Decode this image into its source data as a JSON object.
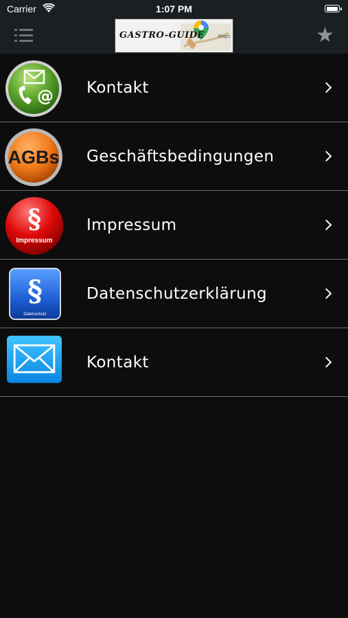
{
  "status_bar": {
    "carrier": "Carrier",
    "time": "1:07 PM"
  },
  "nav": {
    "logo_text": "GASTRO-GUIDE",
    "logo_maps": "Maps",
    "menu_icon": "hamburger-icon",
    "favorite_icon": "star-icon"
  },
  "list": {
    "items": [
      {
        "label": "Kontakt",
        "icon": "phone-mail-icon"
      },
      {
        "label": "Geschäftsbedingungen",
        "icon": "agbs-icon",
        "icon_text": "AGBs"
      },
      {
        "label": "Impressum",
        "icon": "impressum-icon",
        "icon_text": "Impressum"
      },
      {
        "label": "Datenschutzerklärung",
        "icon": "datenschutz-icon",
        "icon_text": "Datenschutz"
      },
      {
        "label": "Kontakt",
        "icon": "mail-icon"
      }
    ]
  },
  "colors": {
    "background": "#0d0d0d",
    "bar": "#1c1f22",
    "divider": "#6e6e6e",
    "text": "#ffffff"
  }
}
